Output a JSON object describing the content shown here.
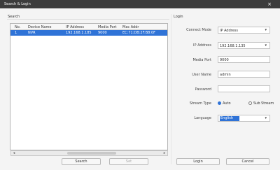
{
  "window": {
    "title": "Search & Login",
    "close_glyph": "×"
  },
  "search": {
    "header": "Search",
    "columns": [
      "No.",
      "Device Name",
      "IP Address",
      "Media Port",
      "Mac Addr"
    ],
    "rows": [
      {
        "no": "1",
        "device_name": "NVR",
        "ip": "192.168.1.185",
        "media_port": "9000",
        "mac": "EC:71:DB:2F:B8:0F"
      }
    ],
    "search_button": "Search",
    "set_button": "Set"
  },
  "login": {
    "header": "Login",
    "connect_mode": {
      "label": "Connect Mode",
      "value": "IP Address"
    },
    "ip_address": {
      "label": "IP Address",
      "value": "192.168.1.135"
    },
    "media_port": {
      "label": "Media Port",
      "value": "9000"
    },
    "user_name": {
      "label": "User Name",
      "value": "admin"
    },
    "password": {
      "label": "Password",
      "value": ""
    },
    "stream_type": {
      "label": "Stream Type",
      "options": [
        "Auto",
        "Sub Stream"
      ],
      "selected": "Auto"
    },
    "language": {
      "label": "Language",
      "value": "English"
    },
    "login_button": "Login",
    "cancel_button": "Cancel"
  },
  "colors": {
    "accent": "#2f73d7",
    "titlebar": "#3c3c3c"
  }
}
